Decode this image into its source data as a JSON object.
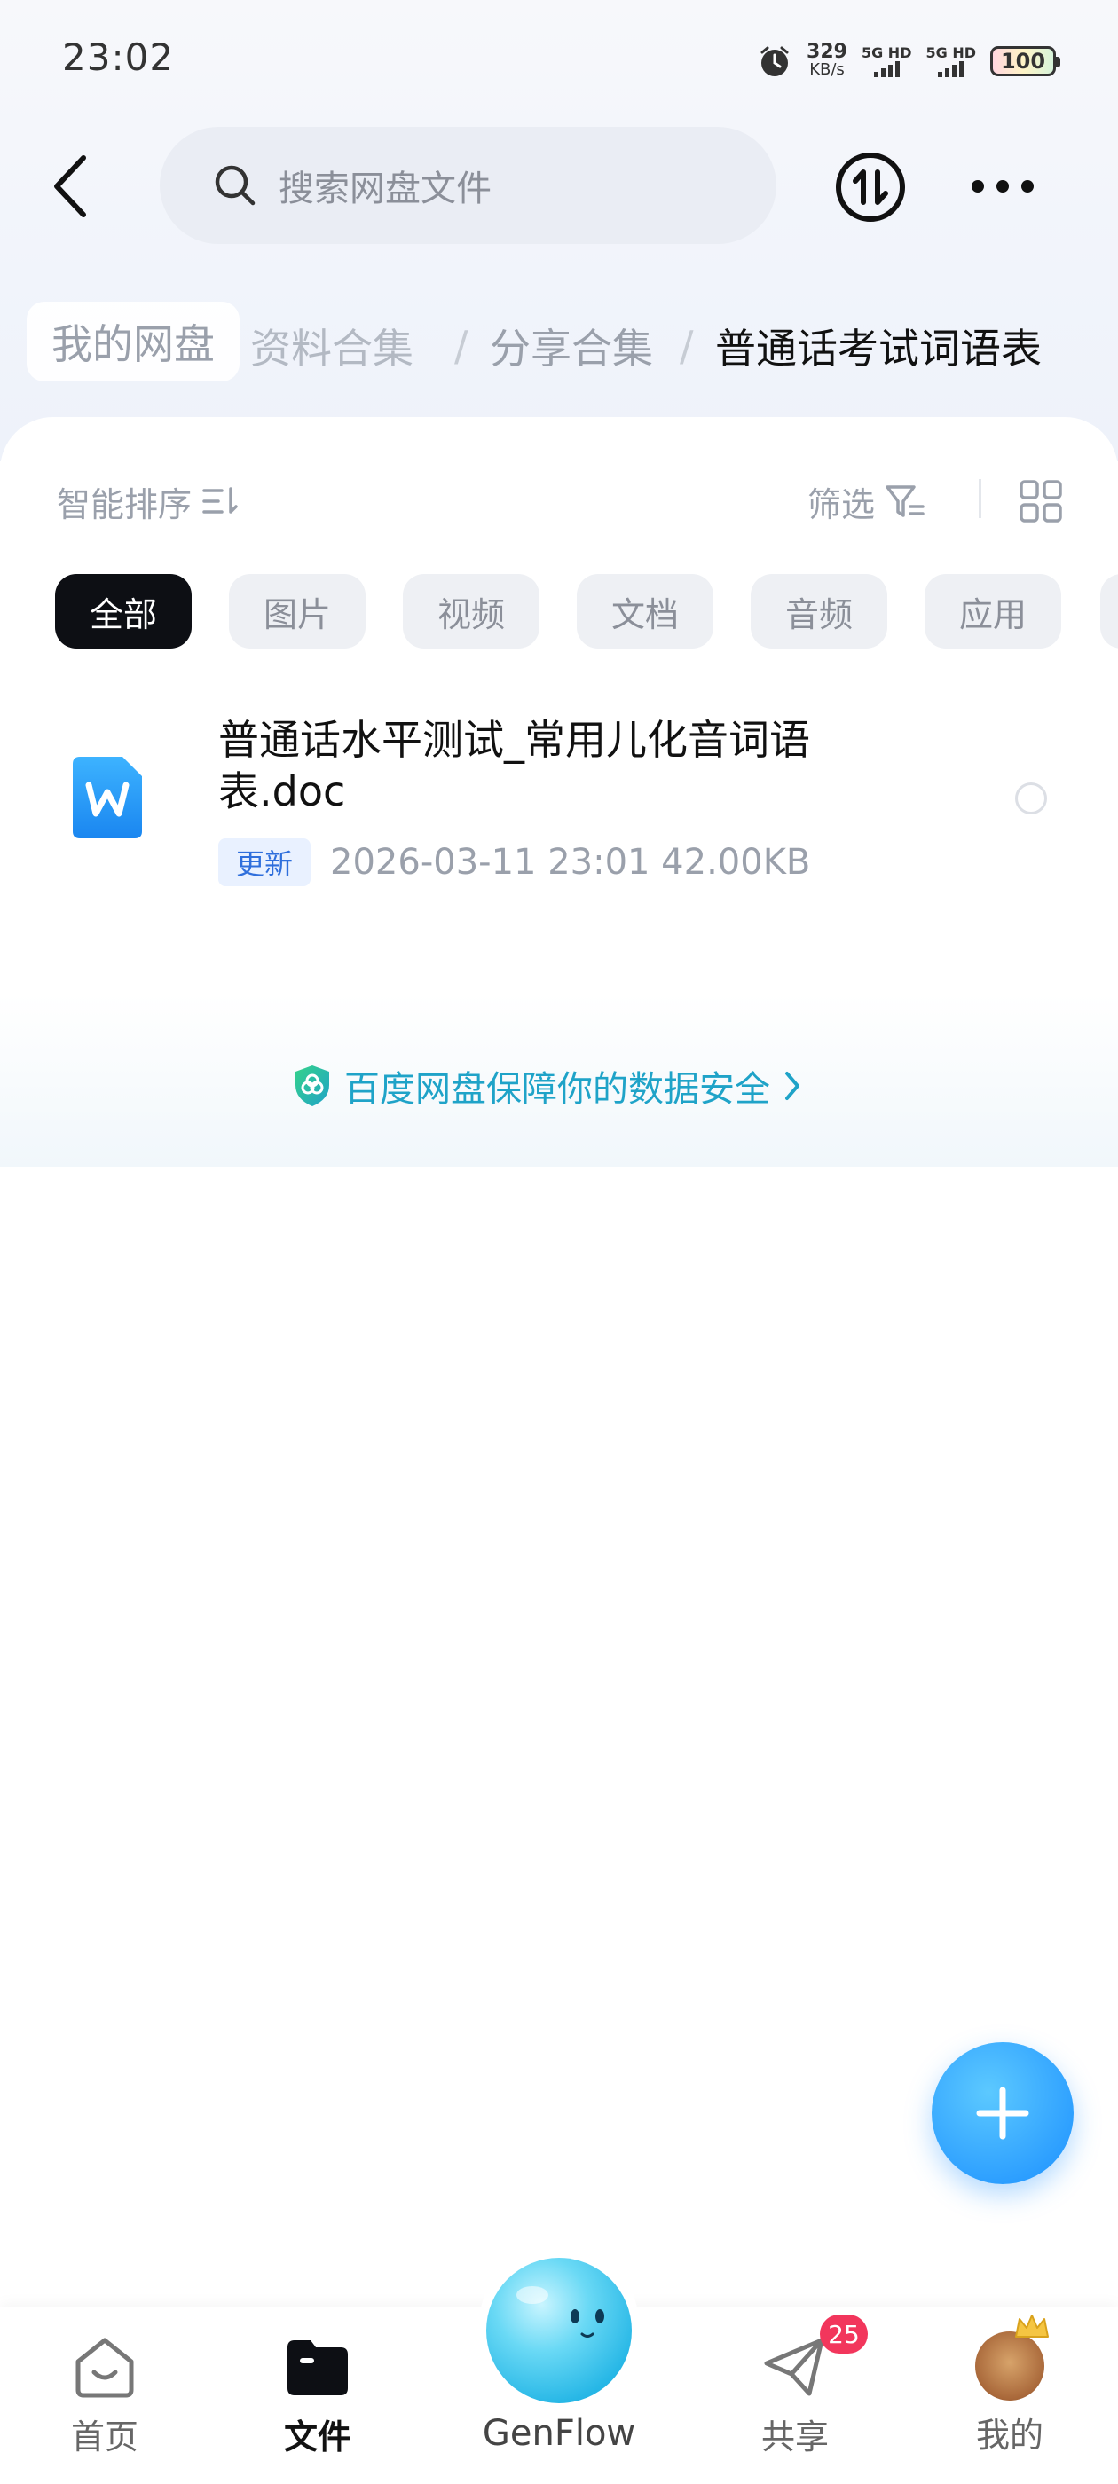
{
  "status_bar": {
    "time": "23:02",
    "net_speed_value": "329",
    "net_speed_unit": "KB/s",
    "sim1_label": "5G HD",
    "sim2_label": "5G HD",
    "battery": "100"
  },
  "header": {
    "search_placeholder": "搜索网盘文件"
  },
  "breadcrumb": {
    "home": "我的网盘",
    "faded": "资料合集",
    "sep": "/",
    "share": "分享合集",
    "current": "普通话考试词语表"
  },
  "toolbar": {
    "sort_label": "智能排序",
    "filter_label": "筛选"
  },
  "categories": [
    "全部",
    "图片",
    "视频",
    "文档",
    "音频",
    "应用"
  ],
  "active_category": "全部",
  "files": [
    {
      "name": "普通话水平测试_常用儿化音词语表.doc",
      "badge": "更新",
      "meta": "2026-03-11  23:01  42.00KB"
    }
  ],
  "security_banner": {
    "text": "百度网盘保障你的数据安全"
  },
  "bottom_nav": {
    "home": "首页",
    "files": "文件",
    "genflow": "GenFlow",
    "share": "共享",
    "share_badge": "25",
    "mine": "我的"
  },
  "colors": {
    "accent": "#1b8fff",
    "security_teal": "#1fa3c8",
    "badge_red": "#f2365c",
    "active_chip": "#0d0f14"
  }
}
